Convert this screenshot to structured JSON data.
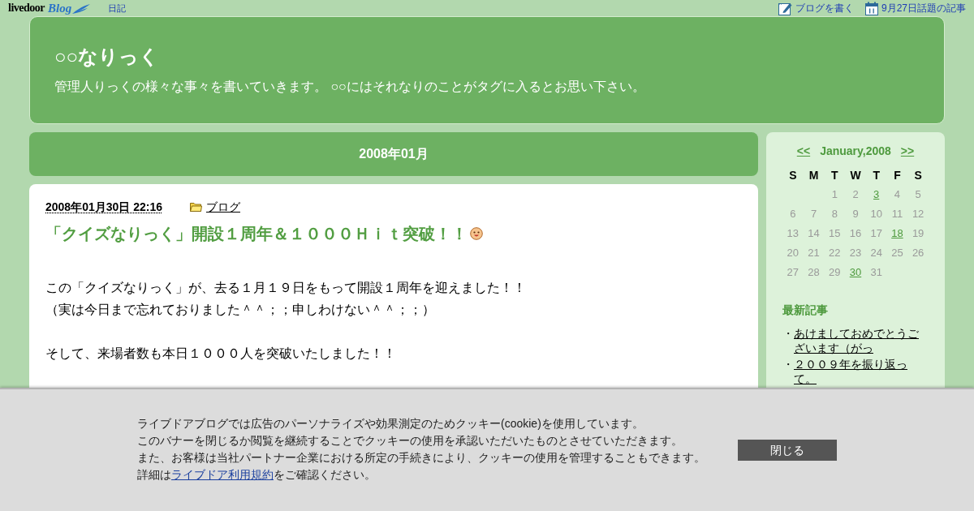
{
  "top_bar": {
    "logo": {
      "wordmark": "livedoor",
      "blog": "Blog"
    },
    "left_links": [
      "日記"
    ],
    "right_links": [
      {
        "kind": "write",
        "label": "ブログを書く"
      },
      {
        "kind": "calendar",
        "label": "9月27日話題の記事"
      }
    ]
  },
  "header": {
    "title": "○○なりっく",
    "description": "管理人りっくの様々な事々を書いていきます。 ○○にはそれなりのことがタグに入るとお思い下さい。"
  },
  "archive_heading": "2008年01月",
  "article": {
    "date": "2008年01月30日 22:16",
    "category": "ブログ",
    "title": "「クイズなりっく」開設１周年＆１０００Ｈｉｔ突破！！",
    "paragraphs": [
      [
        "この「クイズなりっく」が、去る１月１９日をもって開設１周年を迎えました！！",
        "（実は今日まで忘れておりました＾＾；；申しわけない＾＾；；）"
      ],
      [
        "そして、来場者数も本日１０００人を突破いたしました！！"
      ]
    ]
  },
  "sidebar": {
    "calendar": {
      "prev": "<<",
      "month": "January,2008",
      "next": ">>",
      "weekdays": [
        "S",
        "M",
        "T",
        "W",
        "T",
        "F",
        "S"
      ],
      "weeks": [
        [
          {
            "day": "1",
            "linked": false
          },
          {
            "day": "2",
            "linked": false
          },
          {
            "day": "3",
            "linked": true
          },
          {
            "day": "4",
            "linked": false
          },
          {
            "day": "5",
            "linked": false
          }
        ],
        [
          {
            "day": "6",
            "linked": false
          },
          {
            "day": "7",
            "linked": false
          },
          {
            "day": "8",
            "linked": false
          },
          {
            "day": "9",
            "linked": false
          },
          {
            "day": "10",
            "linked": false
          },
          {
            "day": "11",
            "linked": false
          },
          {
            "day": "12",
            "linked": false
          }
        ],
        [
          {
            "day": "13",
            "linked": false
          },
          {
            "day": "14",
            "linked": false
          },
          {
            "day": "15",
            "linked": false
          },
          {
            "day": "16",
            "linked": false
          },
          {
            "day": "17",
            "linked": false
          },
          {
            "day": "18",
            "linked": true
          },
          {
            "day": "19",
            "linked": false
          }
        ],
        [
          {
            "day": "20",
            "linked": false
          },
          {
            "day": "21",
            "linked": false
          },
          {
            "day": "22",
            "linked": false
          },
          {
            "day": "23",
            "linked": false
          },
          {
            "day": "24",
            "linked": false
          },
          {
            "day": "25",
            "linked": false
          },
          {
            "day": "26",
            "linked": false
          }
        ],
        [
          {
            "day": "27",
            "linked": false
          },
          {
            "day": "28",
            "linked": false
          },
          {
            "day": "29",
            "linked": false
          },
          {
            "day": "30",
            "linked": true
          },
          {
            "day": "31",
            "linked": false
          }
        ]
      ]
    },
    "recent": {
      "heading": "最新記事",
      "items": [
        {
          "bullet": "・",
          "title": "あけましておめでとうございます（がっ"
        },
        {
          "bullet": "・",
          "title": "２００９年を振り返って。"
        }
      ]
    }
  },
  "cookie_banner": {
    "lines": [
      "ライブドアブログでは広告のパーソナライズや効果測定のためクッキー(cookie)を使用しています。",
      "このバナーを閉じるか閲覧を継続することでクッキーの使用を承認いただいたものとさせていただきます。",
      "また、お客様は当社パートナー企業における所定の手続きにより、クッキーの使用を管理することもできます。"
    ],
    "last_line": {
      "before": "詳細は",
      "link": "ライブドア利用規約",
      "after": "をご確認ください。"
    },
    "close": "閉じる"
  }
}
